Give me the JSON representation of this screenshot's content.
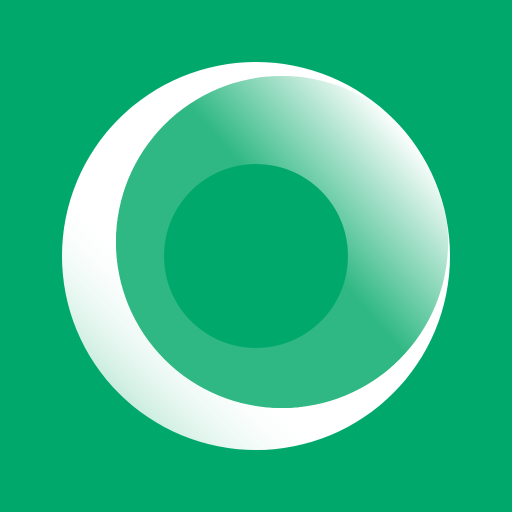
{
  "icon": {
    "name": "ring-logo-icon",
    "colors": {
      "background": "#00A86B",
      "ring": "#FFFFFF",
      "inner_band": "#2FB883",
      "center": "#00A86B"
    }
  }
}
